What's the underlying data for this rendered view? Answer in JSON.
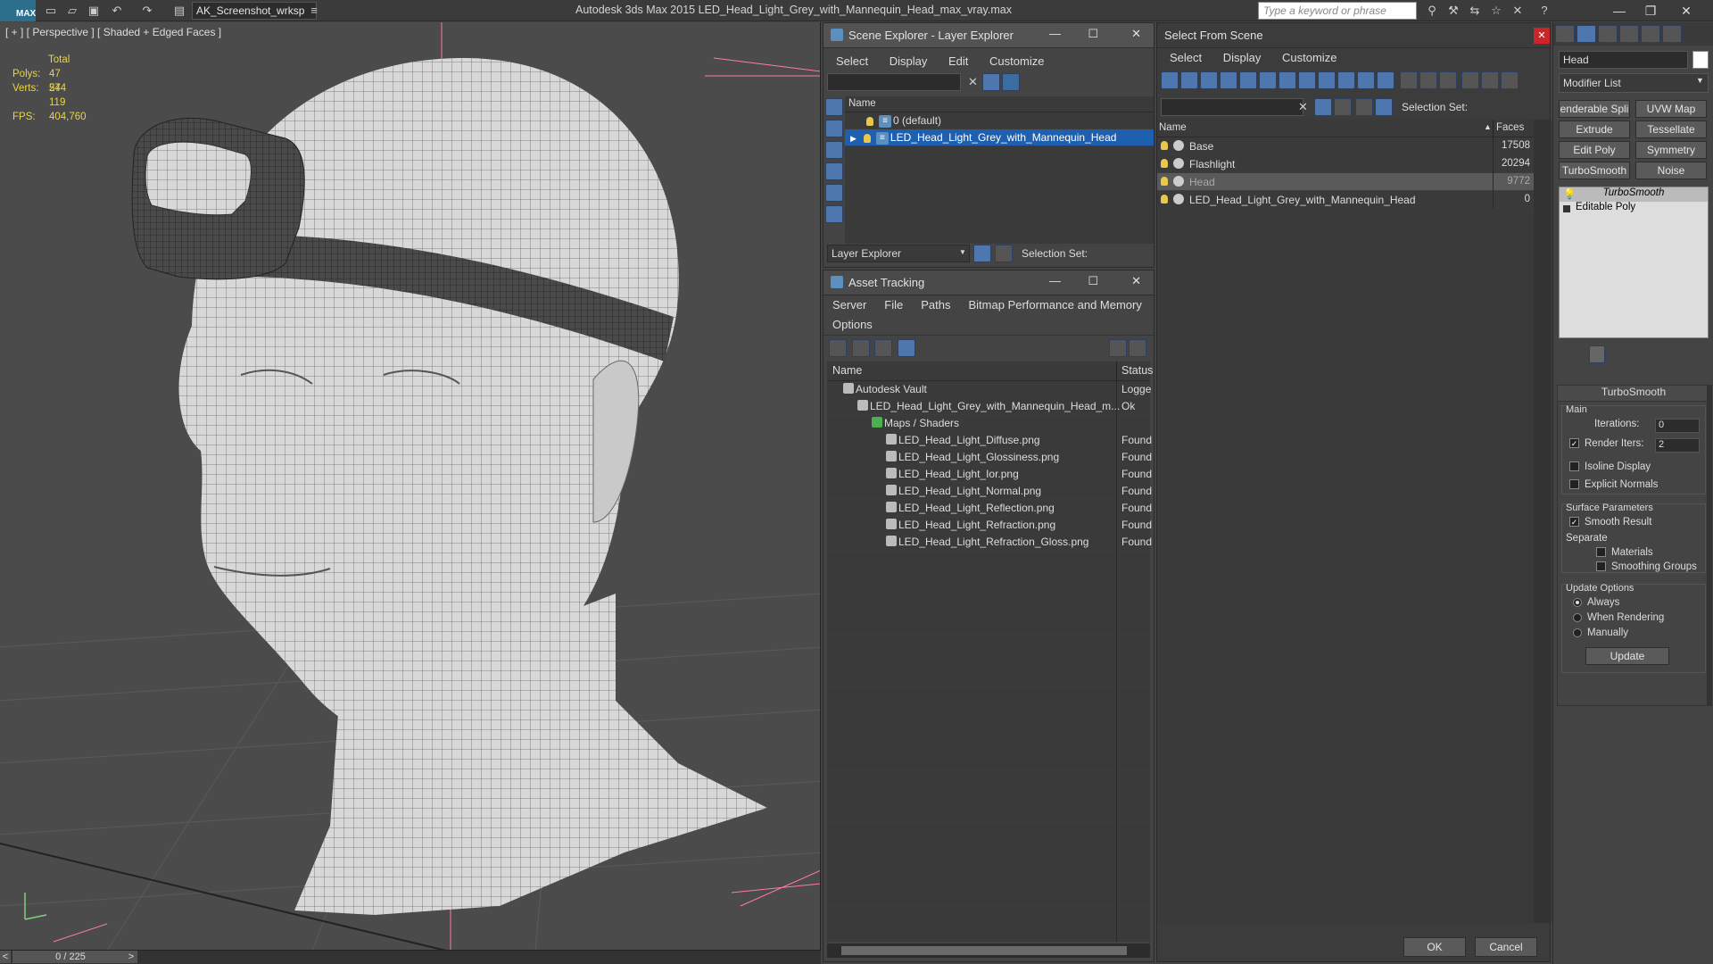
{
  "app": {
    "logo": "MAX",
    "workspace": "AK_Screenshot_wrksp",
    "title": "Autodesk 3ds Max  2015     LED_Head_Light_Grey_with_Mannequin_Head_max_vray.max",
    "search_placeholder": "Type a keyword or phrase"
  },
  "viewport": {
    "label": "[ + ] [ Perspective ] [ Shaded + Edged Faces ]",
    "stats": {
      "total_label": "Total",
      "polys_label": "Polys:",
      "polys": "47 574",
      "verts_label": "Verts:",
      "verts": "24 119",
      "fps_label": "FPS:",
      "fps": "404,760"
    },
    "timeline": "0 / 225"
  },
  "scene_explorer": {
    "title": "Scene Explorer - Layer Explorer",
    "menus": [
      "Select",
      "Display",
      "Edit",
      "Customize"
    ],
    "column": "Name",
    "rows": [
      "0 (default)",
      "LED_Head_Light_Grey_with_Mannequin_Head"
    ],
    "footer_dropdown": "Layer Explorer",
    "selection_set": "Selection Set:"
  },
  "asset_tracking": {
    "title": "Asset Tracking",
    "menus": [
      "Server",
      "File",
      "Paths",
      "Bitmap Performance and Memory"
    ],
    "menus2": [
      "Options"
    ],
    "col_name": "Name",
    "col_status": "Status",
    "rows": [
      {
        "name": "Autodesk Vault",
        "status": "Logge",
        "indent": 0
      },
      {
        "name": "LED_Head_Light_Grey_with_Mannequin_Head_m...",
        "status": "Ok",
        "indent": 1
      },
      {
        "name": "Maps / Shaders",
        "status": "",
        "indent": 2
      },
      {
        "name": "LED_Head_Light_Diffuse.png",
        "status": "Found",
        "indent": 3
      },
      {
        "name": "LED_Head_Light_Glossiness.png",
        "status": "Found",
        "indent": 3
      },
      {
        "name": "LED_Head_Light_Ior.png",
        "status": "Found",
        "indent": 3
      },
      {
        "name": "LED_Head_Light_Normal.png",
        "status": "Found",
        "indent": 3
      },
      {
        "name": "LED_Head_Light_Reflection.png",
        "status": "Found",
        "indent": 3
      },
      {
        "name": "LED_Head_Light_Refraction.png",
        "status": "Found",
        "indent": 3
      },
      {
        "name": "LED_Head_Light_Refraction_Gloss.png",
        "status": "Found",
        "indent": 3
      }
    ]
  },
  "select_from_scene": {
    "title": "Select From Scene",
    "menus": [
      "Select",
      "Display",
      "Customize"
    ],
    "selection_set": "Selection Set:",
    "col_name": "Name",
    "col_faces": "Faces",
    "rows": [
      {
        "name": "Base",
        "faces": "17508"
      },
      {
        "name": "Flashlight",
        "faces": "20294"
      },
      {
        "name": "Head",
        "faces": "9772"
      },
      {
        "name": "LED_Head_Light_Grey_with_Mannequin_Head",
        "faces": "0"
      }
    ],
    "ok": "OK",
    "cancel": "Cancel"
  },
  "command_panel": {
    "object_name": "Head",
    "modifier_list": "Modifier List",
    "buttons": [
      "enderable Spli",
      "UVW Map",
      "Extrude",
      "Tessellate",
      "Edit Poly",
      "Symmetry",
      "TurboSmooth",
      "Noise"
    ],
    "stack": [
      "TurboSmooth",
      "Editable Poly"
    ],
    "rollout": "TurboSmooth",
    "main": "Main",
    "iterations_label": "Iterations:",
    "iterations": "0",
    "render_iters_label": "Render Iters:",
    "render_iters": "2",
    "isoline": "Isoline Display",
    "explicit": "Explicit Normals",
    "surface": "Surface Parameters",
    "smooth_result": "Smooth Result",
    "separate": "Separate",
    "materials": "Materials",
    "smoothing_groups": "Smoothing Groups",
    "update_options": "Update Options",
    "always": "Always",
    "when_rendering": "When Rendering",
    "manually": "Manually",
    "update": "Update"
  }
}
